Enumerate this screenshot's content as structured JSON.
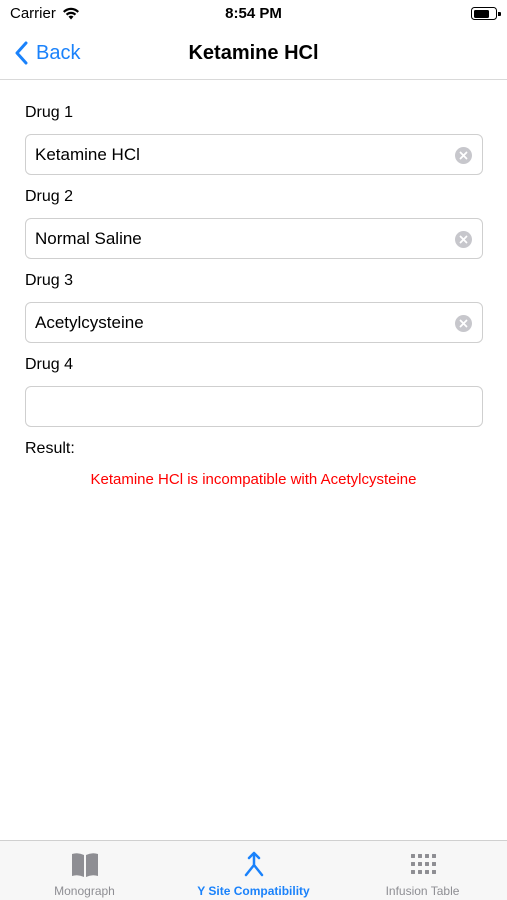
{
  "status_bar": {
    "carrier": "Carrier",
    "time": "8:54 PM",
    "battery_level": 0.75
  },
  "nav": {
    "back_label": "Back",
    "title": "Ketamine HCl"
  },
  "fields": [
    {
      "label": "Drug 1",
      "value": "Ketamine HCl"
    },
    {
      "label": "Drug 2",
      "value": "Normal Saline"
    },
    {
      "label": "Drug 3",
      "value": "Acetylcysteine"
    },
    {
      "label": "Drug 4",
      "value": ""
    }
  ],
  "result": {
    "label": "Result:",
    "text": "Ketamine HCl is incompatible with Acetylcysteine",
    "color": "#ff0000"
  },
  "tabs": [
    {
      "label": "Monograph",
      "icon": "book-icon",
      "active": false
    },
    {
      "label": "Y Site Compatibility",
      "icon": "merge-arrow-icon",
      "active": true
    },
    {
      "label": "Infusion Table",
      "icon": "grid-icon",
      "active": false
    }
  ],
  "colors": {
    "accent": "#1a82fb",
    "inactive": "#8e8e93",
    "error": "#ff0000"
  }
}
